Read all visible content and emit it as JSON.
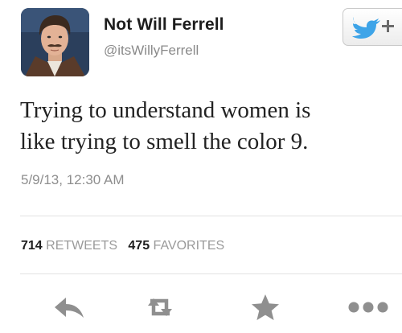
{
  "tweet": {
    "display_name": "Not Will Ferrell",
    "handle": "@itsWillyFerrell",
    "text_line1": "Trying to understand women is",
    "text_line2": "like trying to smell the color 9.",
    "timestamp": "5/9/13, 12:30 AM"
  },
  "stats": {
    "retweets_count": "714",
    "retweets_label": "RETWEETS",
    "favorites_count": "475",
    "favorites_label": "FAVORITES"
  },
  "actions": {
    "reply": "reply-icon",
    "retweet": "retweet-icon",
    "favorite": "star-icon",
    "more": "more-icon"
  },
  "colors": {
    "twitter_blue": "#3ea4e8",
    "icon_gray": "#8f8f8f",
    "meta_gray": "#8e8e8e"
  }
}
